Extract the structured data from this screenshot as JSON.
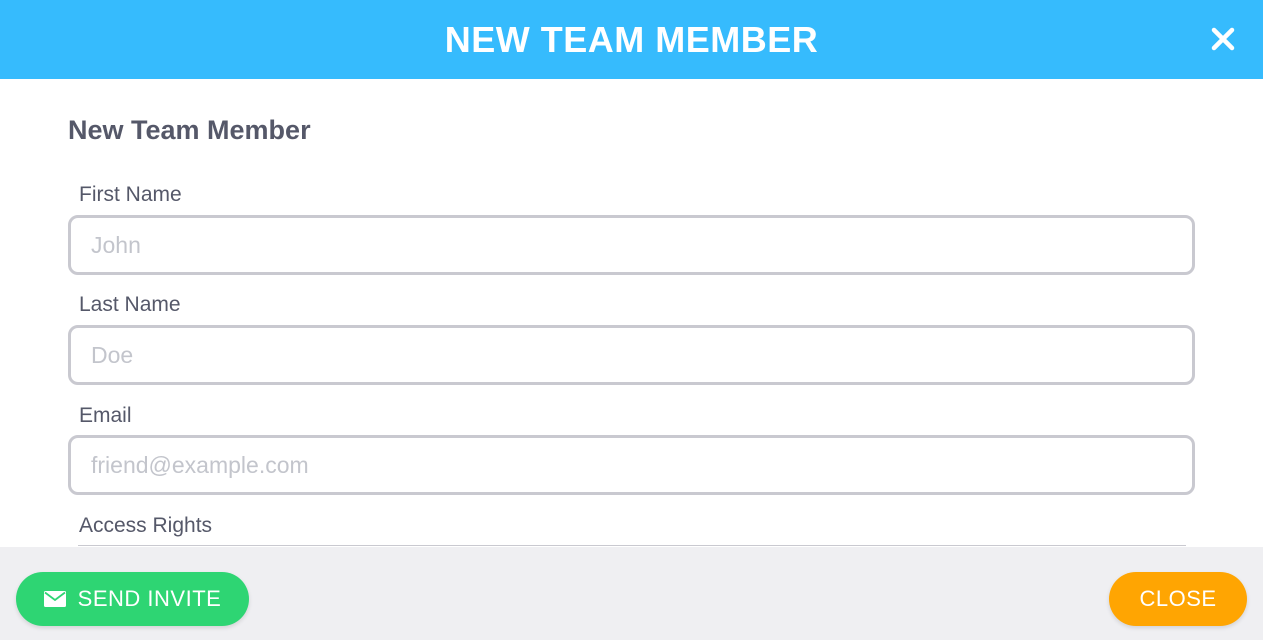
{
  "header": {
    "title": "NEW TEAM MEMBER",
    "close_icon": "close-x-icon"
  },
  "form": {
    "section_title": "New Team Member",
    "first_name": {
      "label": "First Name",
      "placeholder": "John",
      "value": ""
    },
    "last_name": {
      "label": "Last Name",
      "placeholder": "Doe",
      "value": ""
    },
    "email": {
      "label": "Email",
      "placeholder": "friend@example.com",
      "value": ""
    },
    "access_rights": {
      "label": "Access Rights"
    }
  },
  "footer": {
    "send_invite_label": "SEND INVITE",
    "send_invite_icon": "envelope-icon",
    "close_label": "CLOSE"
  },
  "colors": {
    "header": "#36bbfd",
    "send_button": "#2ed573",
    "close_button": "#ffa502",
    "text": "#555869",
    "footer_bg": "#efeff2"
  }
}
